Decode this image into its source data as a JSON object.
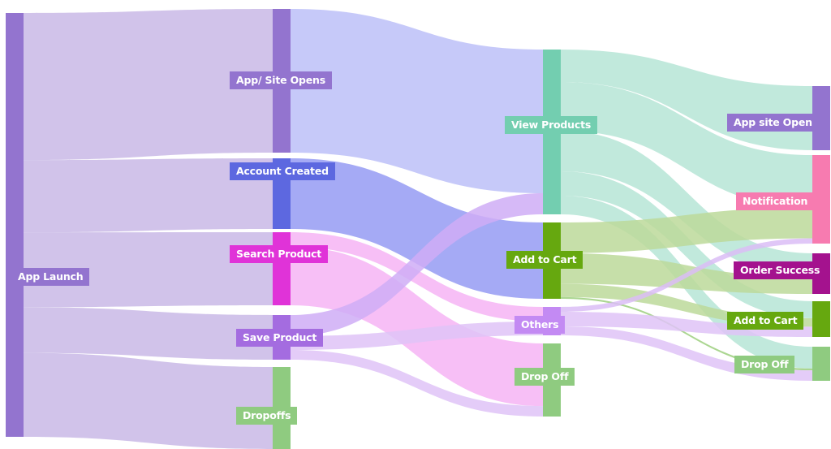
{
  "chart_data": {
    "type": "sankey",
    "title": "",
    "nodes": [
      {
        "id": "app_launch",
        "label": "App Launch",
        "stage": 0,
        "color": "#9374cf"
      },
      {
        "id": "app_site_opens",
        "label": "App/ Site Opens",
        "stage": 1,
        "color": "#9374cf"
      },
      {
        "id": "account_created",
        "label": "Account Created",
        "stage": 1,
        "color": "#5d68e0"
      },
      {
        "id": "search_product",
        "label": "Search Product",
        "stage": 1,
        "color": "#e033d8"
      },
      {
        "id": "save_product",
        "label": "Save Product",
        "stage": 1,
        "color": "#a46ce0"
      },
      {
        "id": "dropoffs",
        "label": "Dropoffs",
        "stage": 1,
        "color": "#8fcb80"
      },
      {
        "id": "view_products",
        "label": "View Products",
        "stage": 2,
        "color": "#73ceb0"
      },
      {
        "id": "add_to_cart_mid",
        "label": "Add to Cart",
        "stage": 2,
        "color": "#66a80f"
      },
      {
        "id": "others",
        "label": "Others",
        "stage": 2,
        "color": "#c38af3"
      },
      {
        "id": "drop_off_mid",
        "label": "Drop Off",
        "stage": 2,
        "color": "#8fcb80"
      },
      {
        "id": "app_site_open",
        "label": "App site Open",
        "stage": 3,
        "color": "#9374cf"
      },
      {
        "id": "notification",
        "label": "Notification",
        "stage": 3,
        "color": "#f77bb0"
      },
      {
        "id": "order_success",
        "label": "Order Success",
        "stage": 3,
        "color": "#a4128e"
      },
      {
        "id": "add_to_cart_right",
        "label": "Add to Cart",
        "stage": 3,
        "color": "#66a80f"
      },
      {
        "id": "drop_off_right",
        "label": "Drop Off",
        "stage": 3,
        "color": "#8fcb80"
      }
    ],
    "links": [
      {
        "source": "app_launch",
        "target": "app_site_opens",
        "value": 177,
        "color": "#c9b8e6"
      },
      {
        "source": "app_launch",
        "target": "account_created",
        "value": 87,
        "color": "#c9b8e6"
      },
      {
        "source": "app_launch",
        "target": "search_product",
        "value": 90,
        "color": "#c9b8e6"
      },
      {
        "source": "app_launch",
        "target": "save_product",
        "value": 55,
        "color": "#c9b8e6"
      },
      {
        "source": "app_launch",
        "target": "dropoffs",
        "value": 101,
        "color": "#c9b8e6"
      },
      {
        "source": "app_site_opens",
        "target": "view_products",
        "value": 177,
        "color": "#bcbff8"
      },
      {
        "source": "account_created",
        "target": "add_to_cart_mid",
        "value": 87,
        "color": "#959bf3"
      },
      {
        "source": "search_product",
        "target": "others",
        "value": 18,
        "color": "#f6b4f4"
      },
      {
        "source": "search_product",
        "target": "drop_off_mid",
        "value": 72,
        "color": "#f6b4f4"
      },
      {
        "source": "save_product",
        "target": "view_products",
        "value": 26,
        "color": "#cfadf6"
      },
      {
        "source": "save_product",
        "target": "others",
        "value": 17,
        "color": "#dfc3f7"
      },
      {
        "source": "save_product",
        "target": "drop_off_mid",
        "value": 12,
        "color": "#dfc3f7"
      },
      {
        "source": "view_products",
        "target": "app_site_open",
        "value": 40,
        "color": "#b6e5d6"
      },
      {
        "source": "view_products",
        "target": "notification",
        "value": 60,
        "color": "#b6e5d6"
      },
      {
        "source": "view_products",
        "target": "order_success",
        "value": 50,
        "color": "#b6e5d6"
      },
      {
        "source": "view_products",
        "target": "add_to_cart_right",
        "value": 30,
        "color": "#b6e5d6"
      },
      {
        "source": "view_products",
        "target": "drop_off_right",
        "value": 23,
        "color": "#b6e5d6"
      },
      {
        "source": "add_to_cart_mid",
        "target": "notification",
        "value": 35,
        "color": "#bcd99a"
      },
      {
        "source": "add_to_cart_mid",
        "target": "order_success",
        "value": 35,
        "color": "#bcd99a"
      },
      {
        "source": "add_to_cart_mid",
        "target": "add_to_cart_right",
        "value": 15,
        "color": "#bcd99a"
      },
      {
        "source": "add_to_cart_mid",
        "target": "drop_off_right",
        "value": 2,
        "color": "#9ccf7e"
      },
      {
        "source": "others",
        "target": "notification",
        "value": 6,
        "color": "#dbbdf6"
      },
      {
        "source": "others",
        "target": "add_to_cart_right",
        "value": 18,
        "color": "#dfc3f7"
      },
      {
        "source": "others",
        "target": "drop_off_right",
        "value": 11,
        "color": "#dfc3f7"
      }
    ]
  }
}
